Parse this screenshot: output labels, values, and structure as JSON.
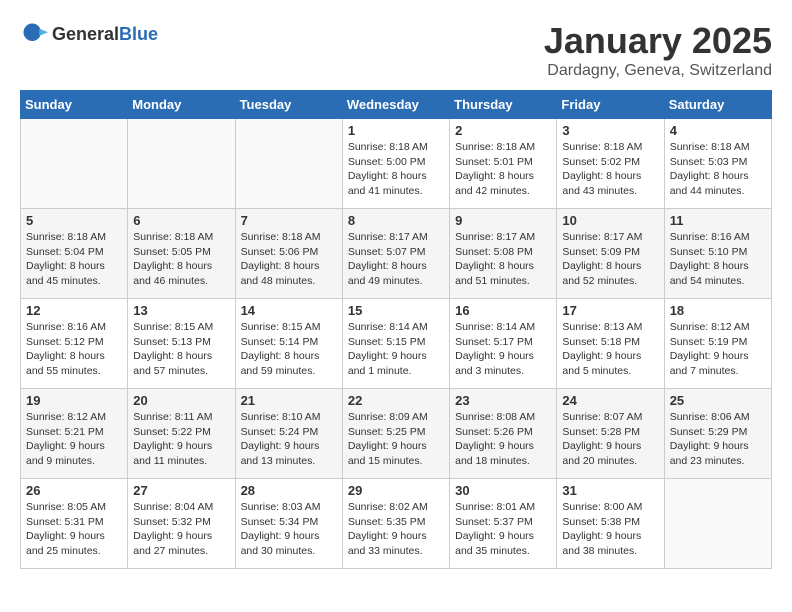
{
  "header": {
    "logo_general": "General",
    "logo_blue": "Blue",
    "month": "January 2025",
    "location": "Dardagny, Geneva, Switzerland"
  },
  "days_of_week": [
    "Sunday",
    "Monday",
    "Tuesday",
    "Wednesday",
    "Thursday",
    "Friday",
    "Saturday"
  ],
  "weeks": [
    [
      {
        "day": "",
        "info": ""
      },
      {
        "day": "",
        "info": ""
      },
      {
        "day": "",
        "info": ""
      },
      {
        "day": "1",
        "info": "Sunrise: 8:18 AM\nSunset: 5:00 PM\nDaylight: 8 hours\nand 41 minutes."
      },
      {
        "day": "2",
        "info": "Sunrise: 8:18 AM\nSunset: 5:01 PM\nDaylight: 8 hours\nand 42 minutes."
      },
      {
        "day": "3",
        "info": "Sunrise: 8:18 AM\nSunset: 5:02 PM\nDaylight: 8 hours\nand 43 minutes."
      },
      {
        "day": "4",
        "info": "Sunrise: 8:18 AM\nSunset: 5:03 PM\nDaylight: 8 hours\nand 44 minutes."
      }
    ],
    [
      {
        "day": "5",
        "info": "Sunrise: 8:18 AM\nSunset: 5:04 PM\nDaylight: 8 hours\nand 45 minutes."
      },
      {
        "day": "6",
        "info": "Sunrise: 8:18 AM\nSunset: 5:05 PM\nDaylight: 8 hours\nand 46 minutes."
      },
      {
        "day": "7",
        "info": "Sunrise: 8:18 AM\nSunset: 5:06 PM\nDaylight: 8 hours\nand 48 minutes."
      },
      {
        "day": "8",
        "info": "Sunrise: 8:17 AM\nSunset: 5:07 PM\nDaylight: 8 hours\nand 49 minutes."
      },
      {
        "day": "9",
        "info": "Sunrise: 8:17 AM\nSunset: 5:08 PM\nDaylight: 8 hours\nand 51 minutes."
      },
      {
        "day": "10",
        "info": "Sunrise: 8:17 AM\nSunset: 5:09 PM\nDaylight: 8 hours\nand 52 minutes."
      },
      {
        "day": "11",
        "info": "Sunrise: 8:16 AM\nSunset: 5:10 PM\nDaylight: 8 hours\nand 54 minutes."
      }
    ],
    [
      {
        "day": "12",
        "info": "Sunrise: 8:16 AM\nSunset: 5:12 PM\nDaylight: 8 hours\nand 55 minutes."
      },
      {
        "day": "13",
        "info": "Sunrise: 8:15 AM\nSunset: 5:13 PM\nDaylight: 8 hours\nand 57 minutes."
      },
      {
        "day": "14",
        "info": "Sunrise: 8:15 AM\nSunset: 5:14 PM\nDaylight: 8 hours\nand 59 minutes."
      },
      {
        "day": "15",
        "info": "Sunrise: 8:14 AM\nSunset: 5:15 PM\nDaylight: 9 hours\nand 1 minute."
      },
      {
        "day": "16",
        "info": "Sunrise: 8:14 AM\nSunset: 5:17 PM\nDaylight: 9 hours\nand 3 minutes."
      },
      {
        "day": "17",
        "info": "Sunrise: 8:13 AM\nSunset: 5:18 PM\nDaylight: 9 hours\nand 5 minutes."
      },
      {
        "day": "18",
        "info": "Sunrise: 8:12 AM\nSunset: 5:19 PM\nDaylight: 9 hours\nand 7 minutes."
      }
    ],
    [
      {
        "day": "19",
        "info": "Sunrise: 8:12 AM\nSunset: 5:21 PM\nDaylight: 9 hours\nand 9 minutes."
      },
      {
        "day": "20",
        "info": "Sunrise: 8:11 AM\nSunset: 5:22 PM\nDaylight: 9 hours\nand 11 minutes."
      },
      {
        "day": "21",
        "info": "Sunrise: 8:10 AM\nSunset: 5:24 PM\nDaylight: 9 hours\nand 13 minutes."
      },
      {
        "day": "22",
        "info": "Sunrise: 8:09 AM\nSunset: 5:25 PM\nDaylight: 9 hours\nand 15 minutes."
      },
      {
        "day": "23",
        "info": "Sunrise: 8:08 AM\nSunset: 5:26 PM\nDaylight: 9 hours\nand 18 minutes."
      },
      {
        "day": "24",
        "info": "Sunrise: 8:07 AM\nSunset: 5:28 PM\nDaylight: 9 hours\nand 20 minutes."
      },
      {
        "day": "25",
        "info": "Sunrise: 8:06 AM\nSunset: 5:29 PM\nDaylight: 9 hours\nand 23 minutes."
      }
    ],
    [
      {
        "day": "26",
        "info": "Sunrise: 8:05 AM\nSunset: 5:31 PM\nDaylight: 9 hours\nand 25 minutes."
      },
      {
        "day": "27",
        "info": "Sunrise: 8:04 AM\nSunset: 5:32 PM\nDaylight: 9 hours\nand 27 minutes."
      },
      {
        "day": "28",
        "info": "Sunrise: 8:03 AM\nSunset: 5:34 PM\nDaylight: 9 hours\nand 30 minutes."
      },
      {
        "day": "29",
        "info": "Sunrise: 8:02 AM\nSunset: 5:35 PM\nDaylight: 9 hours\nand 33 minutes."
      },
      {
        "day": "30",
        "info": "Sunrise: 8:01 AM\nSunset: 5:37 PM\nDaylight: 9 hours\nand 35 minutes."
      },
      {
        "day": "31",
        "info": "Sunrise: 8:00 AM\nSunset: 5:38 PM\nDaylight: 9 hours\nand 38 minutes."
      },
      {
        "day": "",
        "info": ""
      }
    ]
  ]
}
